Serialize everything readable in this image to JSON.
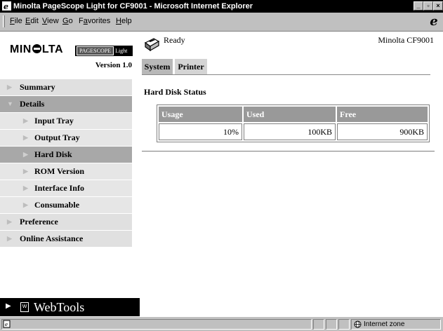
{
  "window": {
    "title": "Minolta PageScope Light for CF9001 - Microsoft Internet Explorer"
  },
  "menu": [
    {
      "label": "File",
      "accel": "F",
      "rest": "ile"
    },
    {
      "label": "Edit",
      "accel": "E",
      "rest": "dit"
    },
    {
      "label": "View",
      "accel": "V",
      "rest": "iew"
    },
    {
      "label": "Go",
      "accel": "G",
      "rest": "o"
    },
    {
      "label": "Favorites",
      "accel": "a",
      "pre": "F",
      "rest": "vorites"
    },
    {
      "label": "Help",
      "accel": "H",
      "rest": "elp"
    }
  ],
  "brand": {
    "logo": "MINOLTA",
    "badge": "PAGESCOPE Light",
    "version": "Version 1.0"
  },
  "nav": {
    "summary": "Summary",
    "details": "Details",
    "input_tray": "Input Tray",
    "output_tray": "Output Tray",
    "hard_disk": "Hard Disk",
    "rom_version": "ROM Version",
    "interface_info": "Interface Info",
    "consumable": "Consumable",
    "preference": "Preference",
    "online_assistance": "Online Assistance",
    "webtools": "WebTools"
  },
  "header": {
    "status": "Ready",
    "device": "Minolta CF9001"
  },
  "tabs": {
    "system": "System",
    "printer": "Printer"
  },
  "hard_disk": {
    "title": "Hard Disk Status",
    "columns": [
      "Usage",
      "Used",
      "Free"
    ],
    "row": [
      "10%",
      "100KB",
      "900KB"
    ]
  },
  "statusbar": {
    "zone": "Internet zone"
  },
  "colors": {
    "titlebar": "#000000",
    "nav_bg": "#e0e0e0",
    "nav_active": "#a8a8a8",
    "table_header": "#999999"
  },
  "icons": [
    "ie-icon",
    "minimize-icon",
    "maximize-icon",
    "close-icon",
    "ie-logo-icon",
    "printer-icon",
    "arrow-icon",
    "webtools-icon",
    "page-icon",
    "globe-icon"
  ]
}
